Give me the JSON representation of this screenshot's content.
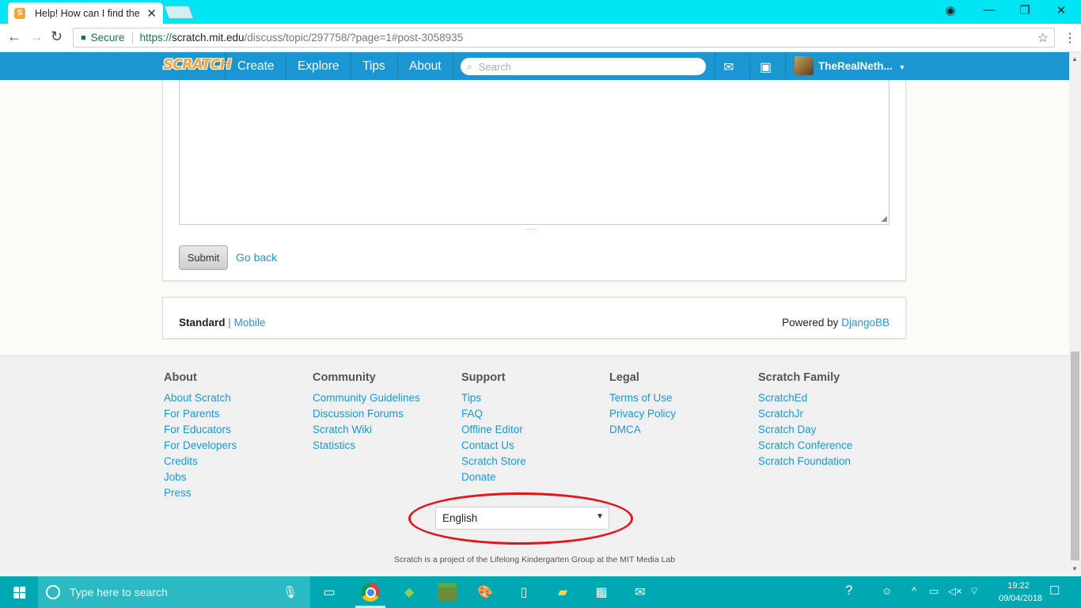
{
  "browser": {
    "tab_title": "Help! How can I find the",
    "tab_favicon": "S",
    "url_secure_label": "Secure",
    "url_scheme": "https://",
    "url_host": "scratch.mit.edu",
    "url_path": "/discuss/topic/297758/?page=1#post-3058935"
  },
  "nav": {
    "logo": "SCRATCH",
    "links": [
      "Create",
      "Explore",
      "Tips",
      "About"
    ],
    "search_placeholder": "Search",
    "username": "TheRealNeth...",
    "brand_color": "#1b96d1"
  },
  "editor": {
    "submit_label": "Submit",
    "goback_label": "Go back"
  },
  "forum_footer": {
    "standard": "Standard",
    "separator": "|",
    "mobile": "Mobile",
    "powered_by": "Powered by",
    "djangobb": "DjangoBB"
  },
  "footer": {
    "columns": [
      {
        "heading": "About",
        "links": [
          "About Scratch",
          "For Parents",
          "For Educators",
          "For Developers",
          "Credits",
          "Jobs",
          "Press"
        ]
      },
      {
        "heading": "Community",
        "links": [
          "Community Guidelines",
          "Discussion Forums",
          "Scratch Wiki",
          "Statistics"
        ]
      },
      {
        "heading": "Support",
        "links": [
          "Tips",
          "FAQ",
          "Offline Editor",
          "Contact Us",
          "Scratch Store",
          "Donate"
        ]
      },
      {
        "heading": "Legal",
        "links": [
          "Terms of Use",
          "Privacy Policy",
          "DMCA"
        ]
      },
      {
        "heading": "Scratch Family",
        "links": [
          "ScratchEd",
          "ScratchJr",
          "Scratch Day",
          "Scratch Conference",
          "Scratch Foundation"
        ]
      }
    ],
    "language": "English",
    "credit": "Scratch is a project of the Lifelong Kindergarten Group at the MIT Media Lab",
    "highlight_color": "#e3141c"
  },
  "taskbar": {
    "search_placeholder": "Type here to search",
    "time": "19:22",
    "date": "09/04/2018"
  }
}
